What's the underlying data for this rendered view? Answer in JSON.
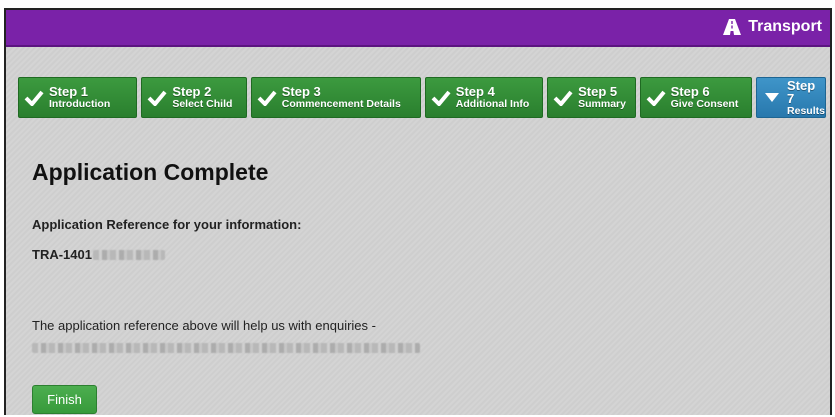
{
  "header": {
    "title": "Transport",
    "icon": "road-icon"
  },
  "steps": [
    {
      "label": "Step 1",
      "sub": "Introduction",
      "state": "complete"
    },
    {
      "label": "Step 2",
      "sub": "Select Child",
      "state": "complete"
    },
    {
      "label": "Step 3",
      "sub": "Commencement Details",
      "state": "complete"
    },
    {
      "label": "Step 4",
      "sub": "Additional Info",
      "state": "complete"
    },
    {
      "label": "Step 5",
      "sub": "Summary",
      "state": "complete"
    },
    {
      "label": "Step 6",
      "sub": "Give Consent",
      "state": "complete"
    },
    {
      "label": "Step 7",
      "sub": "Results",
      "state": "active"
    }
  ],
  "main": {
    "title": "Application Complete",
    "ref_label": "Application Reference for your information:",
    "ref_prefix": "TRA-1401",
    "note": "The application reference above will help us with enquiries -",
    "finish_label": "Finish"
  },
  "colors": {
    "topbar": "#7a22a8",
    "step_complete": "#2f8a33",
    "step_active": "#2d7fb3",
    "finish": "#3fa343"
  }
}
